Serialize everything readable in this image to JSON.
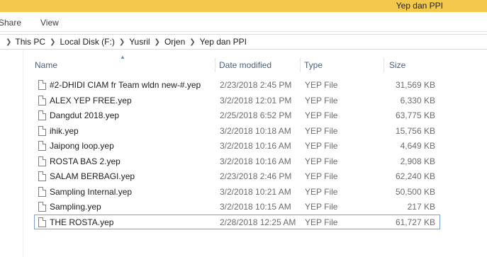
{
  "window": {
    "title": "Yep dan PPI"
  },
  "ribbon": {
    "tabs": [
      "Share",
      "View"
    ]
  },
  "breadcrumb": [
    "This PC",
    "Local Disk (F:)",
    "Yusril",
    "Orjen",
    "Yep dan PPI"
  ],
  "columns": {
    "name": "Name",
    "date": "Date modified",
    "type": "Type",
    "size": "Size"
  },
  "icons": {
    "file": "file-icon",
    "sort": "sort-ascending-icon",
    "separator": "chevron-right-icon"
  },
  "files": [
    {
      "name": "#2-DHIDI CIAM fr Team wldn new-#.yep",
      "date": "2/23/2018 2:45 PM",
      "type": "YEP File",
      "size": "31,569 KB"
    },
    {
      "name": "ALEX YEP FREE.yep",
      "date": "3/2/2018 12:01 PM",
      "type": "YEP File",
      "size": "6,330 KB"
    },
    {
      "name": "Dangdut 2018.yep",
      "date": "2/25/2018 6:52 PM",
      "type": "YEP File",
      "size": "63,775 KB"
    },
    {
      "name": "ihik.yep",
      "date": "3/2/2018 10:18 AM",
      "type": "YEP File",
      "size": "15,756 KB"
    },
    {
      "name": "Jaipong loop.yep",
      "date": "3/2/2018 10:16 AM",
      "type": "YEP File",
      "size": "4,649 KB"
    },
    {
      "name": "ROSTA BAS 2.yep",
      "date": "3/2/2018 10:16 AM",
      "type": "YEP File",
      "size": "2,908 KB"
    },
    {
      "name": "SALAM BERBAGI.yep",
      "date": "2/23/2018 2:46 PM",
      "type": "YEP File",
      "size": "62,240 KB"
    },
    {
      "name": "Sampling Internal.yep",
      "date": "3/2/2018 10:21 AM",
      "type": "YEP File",
      "size": "50,500 KB"
    },
    {
      "name": "Sampling.yep",
      "date": "3/2/2018 10:15 AM",
      "type": "YEP File",
      "size": "217 KB"
    },
    {
      "name": "THE ROSTA.yep",
      "date": "2/28/2018 12:25 AM",
      "type": "YEP File",
      "size": "61,727 KB",
      "selected": true
    }
  ],
  "colors": {
    "titlebar": "#f2c94c",
    "header_text": "#4c607a",
    "selection_border": "#7da2ce"
  }
}
